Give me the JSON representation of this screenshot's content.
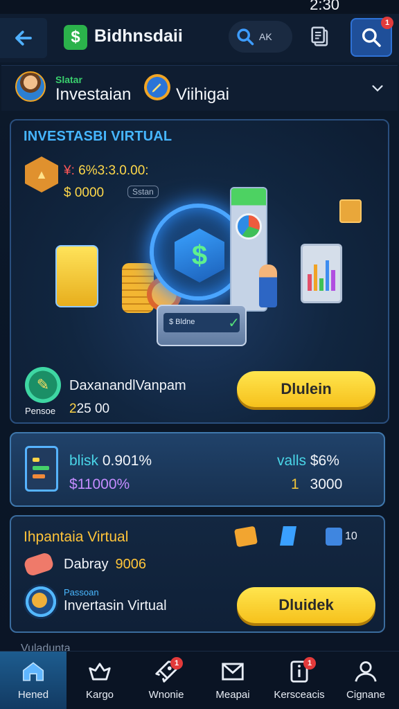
{
  "status_bar": {
    "time": "2:30"
  },
  "topbar": {
    "brand_icon_glyph": "$",
    "title": "Bidhnsdaii",
    "search_placeholder": "AK",
    "notification_count": "1"
  },
  "profile": {
    "small_label": "Slatar",
    "name": "Investaian",
    "secondary": "Viihigai"
  },
  "hero": {
    "title": "INVESTASBI VIRTUAL",
    "line1_prefix": "¥:",
    "line1_value": "6%3:3.0.00:",
    "line2_value": "$ 0000",
    "tag": "Sstan",
    "dollar_glyph": "$",
    "ticket_text": "$ Bldne",
    "ticket_mark": "✓",
    "bottom_icon_label": "Pensoe",
    "subtitle": "DaxanandlVanpam",
    "amount_value": "2",
    "amount_rest": "25 00",
    "button_label": "Dlulein"
  },
  "stats": {
    "left_label": "blisk",
    "left_value": "0.901%",
    "left_sub": "$11000%",
    "right_label": "valls",
    "right_value": "$6%",
    "right_sub_prefix": "1",
    "right_sub_value": "3000"
  },
  "virtual": {
    "title": "Ihpantaia Virtual",
    "count": "10",
    "mid_label": "Dabray",
    "mid_value": "9006",
    "small_label": "Passoan",
    "subtitle": "Invertasin Virtual",
    "button_label": "Dluidek"
  },
  "peek_text": "Vuladunta",
  "nav": [
    {
      "label": "Hened",
      "icon": "home-icon",
      "badge": ""
    },
    {
      "label": "Kargo",
      "icon": "bird-icon",
      "badge": ""
    },
    {
      "label": "Wnonie",
      "icon": "rocket-icon",
      "badge": "1"
    },
    {
      "label": "Meapai",
      "icon": "mail-icon",
      "badge": ""
    },
    {
      "label": "Kersceacis",
      "icon": "info-card-icon",
      "badge": "1"
    },
    {
      "label": "Cignane",
      "icon": "user-icon",
      "badge": ""
    }
  ],
  "colors": {
    "background": "#0d1a2c",
    "accent_blue": "#46b6ff",
    "gold": "#ffd447",
    "green": "#2bb24b",
    "badge_red": "#e23b3b"
  }
}
